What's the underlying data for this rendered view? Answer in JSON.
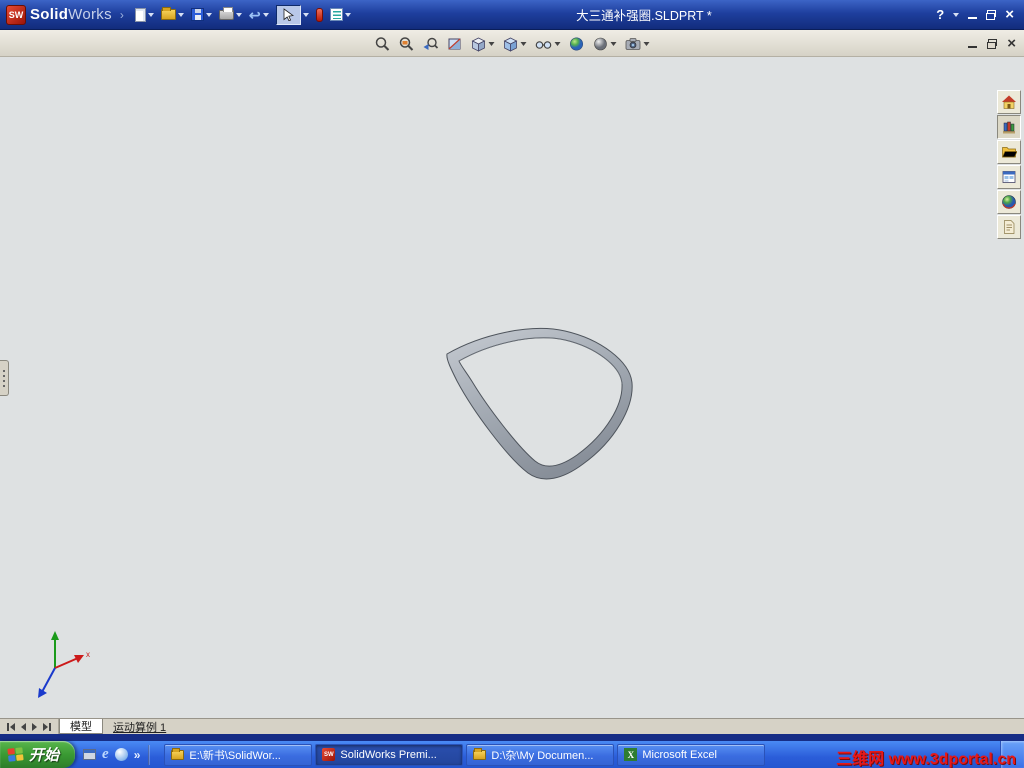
{
  "colors": {
    "titlebar_blue": "#1e3f9e",
    "toolbar_gray": "#d6d2c6",
    "viewport_gray": "#dee1e2",
    "taskbar_blue": "#2b5dd9",
    "start_green": "#3a9a33",
    "watermark_red": "#e81818",
    "model_gray": "#a0a7b0"
  },
  "glyphs": {
    "logo": "SW",
    "brand_arrow": "›",
    "undo": "↩",
    "help": "?",
    "close": "×",
    "chevron_more": "»",
    "ie_e": "e",
    "excel_x": "X",
    "sw_mini": "SW"
  },
  "window": {
    "brand_solid": "Solid",
    "brand_works": "Works",
    "title": "大三通补强圈.SLDPRT *"
  },
  "main_toolbar": {
    "items": [
      {
        "name": "new-document",
        "tooltip": "New"
      },
      {
        "name": "open",
        "tooltip": "Open"
      },
      {
        "name": "save",
        "tooltip": "Save"
      },
      {
        "name": "print",
        "tooltip": "Print"
      },
      {
        "name": "undo",
        "tooltip": "Undo"
      },
      {
        "name": "select",
        "tooltip": "Select"
      },
      {
        "name": "selection-filter",
        "tooltip": "Selection Filter"
      },
      {
        "name": "options-list",
        "tooltip": "Options"
      }
    ]
  },
  "view_toolbar": {
    "items": [
      {
        "name": "zoom-to-fit",
        "tooltip": "Zoom to Fit"
      },
      {
        "name": "zoom-to-area",
        "tooltip": "Zoom to Area"
      },
      {
        "name": "previous-view",
        "tooltip": "Previous View"
      },
      {
        "name": "section-view",
        "tooltip": "Section View"
      },
      {
        "name": "view-orientation",
        "tooltip": "View Orientation"
      },
      {
        "name": "display-style",
        "tooltip": "Display Style"
      },
      {
        "name": "hide-show-items",
        "tooltip": "Hide/Show Items"
      },
      {
        "name": "edit-appearance",
        "tooltip": "Edit Appearance"
      },
      {
        "name": "apply-scene",
        "tooltip": "Apply Scene"
      },
      {
        "name": "view-settings",
        "tooltip": "View Settings"
      }
    ]
  },
  "taskpane": {
    "items": [
      {
        "name": "solidworks-resources"
      },
      {
        "name": "design-library"
      },
      {
        "name": "file-explorer"
      },
      {
        "name": "view-palette"
      },
      {
        "name": "appearances"
      },
      {
        "name": "custom-properties"
      }
    ]
  },
  "bottom_tabs": {
    "model": "模型",
    "motion": "运动算例 1"
  },
  "taskbar": {
    "start": "开始",
    "buttons": [
      {
        "label": "E:\\新书\\SolidWor...",
        "icon": "folder"
      },
      {
        "label": "SolidWorks Premi...",
        "icon": "solidworks"
      },
      {
        "label": "D:\\杂\\My Documen...",
        "icon": "folder"
      },
      {
        "label": "Microsoft Excel",
        "icon": "excel"
      }
    ],
    "watermark": "三维网 www.3dportal.cn"
  }
}
